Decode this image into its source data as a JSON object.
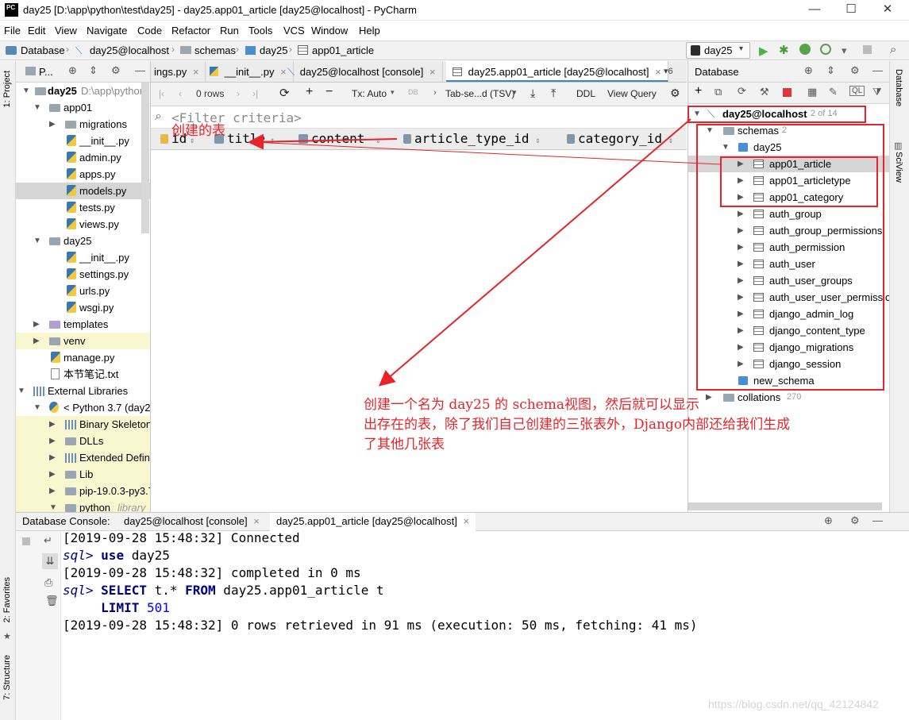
{
  "window": {
    "title": "day25 [D:\\app\\python\\test\\day25] - day25.app01_article [day25@localhost] - PyCharm",
    "app_icon_text": "PC",
    "minimize": "—",
    "maximize": "☐",
    "close": "✕"
  },
  "menu": [
    "File",
    "Edit",
    "View",
    "Navigate",
    "Code",
    "Refactor",
    "Run",
    "Tools",
    "VCS",
    "Window",
    "Help"
  ],
  "breadcrumb": [
    "Database",
    "day25@localhost",
    "schemas",
    "day25",
    "app01_article"
  ],
  "run_config": "day25",
  "left_strip": {
    "project": "1: Project",
    "favorites": "2: Favorites",
    "structure": "7: Structure"
  },
  "right_strip": {
    "database": "Database",
    "sciview": "SciView"
  },
  "project": {
    "header": "P...",
    "root_name": "day25",
    "root_path": "D:\\app\\python",
    "items": [
      "app01",
      "migrations",
      "__init__.py",
      "admin.py",
      "apps.py",
      "models.py",
      "tests.py",
      "views.py",
      "day25",
      "__init__.py",
      "settings.py",
      "urls.py",
      "wsgi.py",
      "templates",
      "venv",
      "manage.py",
      "本节笔记.txt",
      "External Libraries",
      "< Python 3.7 (day2",
      "Binary Skeleton",
      "DLLs",
      "Extended Defin",
      "Lib",
      "pip-19.0.3-py3.7",
      "python"
    ],
    "python_lib_suffix": "library"
  },
  "editor_tabs": [
    "ings.py",
    "__init__.py",
    "day25@localhost [console]",
    "day25.app01_article [day25@localhost]"
  ],
  "editor_tabs_more": "6",
  "data_toolbar": {
    "rows": "0 rows",
    "tx": "Tx: Auto",
    "format": "Tab-se...d (TSV)",
    "ddl": "DDL",
    "view_query": "View Query"
  },
  "filter_placeholder": "<Filter criteria>",
  "columns": [
    "id",
    "title",
    "content",
    "article_type_id",
    "category_id"
  ],
  "database": {
    "header": "Database",
    "connection": "day25@localhost",
    "connection_count": "2 of 14",
    "schemas_label": "schemas",
    "schemas_count": "2",
    "schema_name": "day25",
    "tables": [
      "app01_article",
      "app01_articletype",
      "app01_category",
      "auth_group",
      "auth_group_permissions",
      "auth_permission",
      "auth_user",
      "auth_user_groups",
      "auth_user_user_permissions",
      "django_admin_log",
      "django_content_type",
      "django_migrations",
      "django_session"
    ],
    "new_schema": "new_schema",
    "collations": "collations",
    "collations_count": "270"
  },
  "console": {
    "label": "Database Console:",
    "tabs": [
      "day25@localhost [console]",
      "day25.app01_article [day25@localhost]"
    ],
    "l1_ts": "[2019-09-28 15:48:32]",
    "l1_text": " Connected",
    "l2_prompt": "sql>",
    "l2_kw": "use",
    "l2_rest": " day25",
    "l3_ts": "[2019-09-28 15:48:32]",
    "l3_text": " completed in 0 ms",
    "l4_prompt": "sql>",
    "l4_kw1": "SELECT",
    "l4_mid": " t.* ",
    "l4_kw2": "FROM",
    "l4_rest": " day25.app01_article t",
    "l5_kw": "LIMIT",
    "l5_num": "501",
    "l6_ts": "[2019-09-28 15:48:32]",
    "l6_text": " 0 rows retrieved in 91 ms (execution: 50 ms, fetching: 41 ms)"
  },
  "annotations": {
    "created_table": "创建的表",
    "note_line1": "创建一个名为 day25 的 schema视图，然后就可以显示",
    "note_line2": "出存在的表，除了我们自己创建的三张表外，Django内部还给我们生成",
    "note_line3": "了其他几张表",
    "color": "#e8232a"
  },
  "watermark": "https://blog.csdn.net/qq_42124842"
}
